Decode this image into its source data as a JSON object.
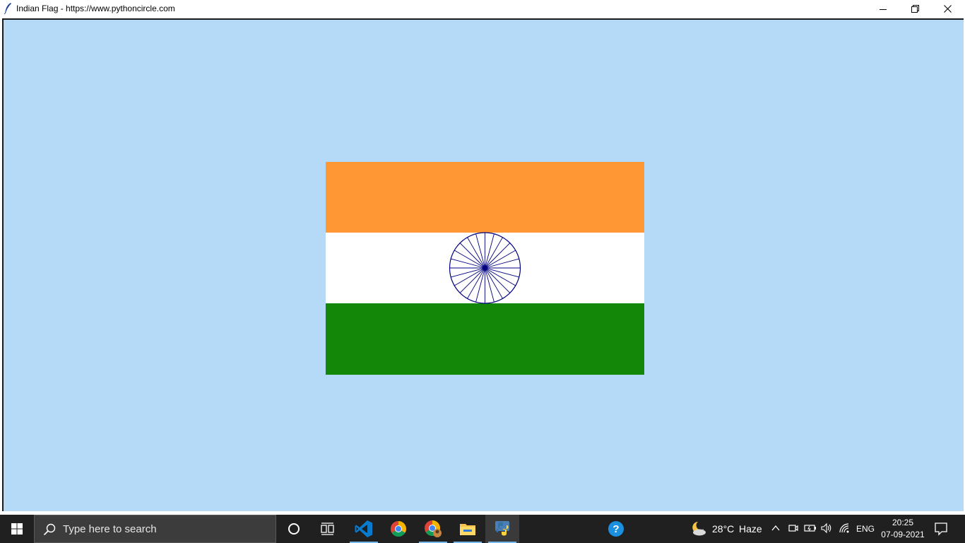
{
  "window": {
    "title": "Indian Flag - https://www.pythoncircle.com",
    "controls": {
      "minimize": "minimize-icon",
      "restore": "restore-icon",
      "close": "close-icon"
    }
  },
  "colors": {
    "canvas_bg": "#b4daf8",
    "saffron": "#ff9735",
    "white": "#ffffff",
    "green": "#138808",
    "chakra": "#000080",
    "taskbar_bg": "#202020"
  },
  "flag": {
    "stripes": [
      "saffron",
      "white",
      "green"
    ],
    "chakra_spokes": 24
  },
  "taskbar": {
    "start": "windows-start-icon",
    "search_placeholder": "Type here to search",
    "apps": [
      {
        "icon": "cortana-icon",
        "running": false
      },
      {
        "icon": "task-view-icon",
        "running": false
      },
      {
        "icon": "vscode-icon",
        "running": true
      },
      {
        "icon": "chrome-icon",
        "running": false
      },
      {
        "icon": "chrome-profile-icon",
        "running": true
      },
      {
        "icon": "file-explorer-icon",
        "running": true
      },
      {
        "icon": "python-icon",
        "running": true,
        "active": true
      }
    ],
    "help_icon": "help-icon",
    "tray": {
      "weather_icon": "moon-cloud-icon",
      "temperature": "28°C",
      "weather": "Haze",
      "language": "ENG",
      "time": "20:25",
      "date": "07-09-2021",
      "notification_icon": "notification-icon"
    }
  }
}
